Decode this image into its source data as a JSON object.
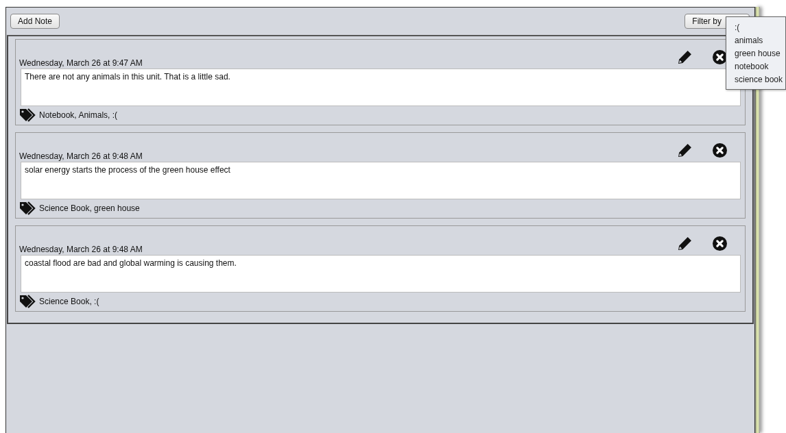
{
  "toolbar": {
    "add_button": "Add Note",
    "filter_button": "Filter by"
  },
  "notes": [
    {
      "date": "Wednesday, March 26 at 9:47 AM",
      "text": "There are not any animals in this unit. That is a little sad.",
      "tags": "Notebook, Animals, :("
    },
    {
      "date": "Wednesday, March 26 at 9:48 AM",
      "text": "solar energy starts the process of the green house effect",
      "tags": "Science Book, green house"
    },
    {
      "date": "Wednesday, March 26 at 9:48 AM",
      "text": "coastal flood are bad and global warming is causing them.",
      "tags": "Science Book, :("
    }
  ],
  "filter_menu": [
    ":(",
    "animals",
    "green house",
    "notebook",
    "science book"
  ]
}
